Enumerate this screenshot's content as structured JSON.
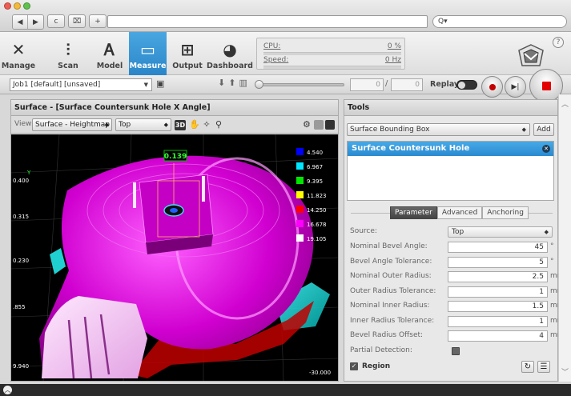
{
  "browser": {
    "nav_back": "◀",
    "nav_forward": "▶",
    "reload": "c",
    "bookmark": "⌧",
    "new_tab": "+",
    "search_prefix": "Q▾"
  },
  "nav": {
    "tabs": [
      {
        "label": "Manage",
        "icon": "wrench-icon",
        "glyph": "✕"
      },
      {
        "label": "Scan",
        "icon": "sliders-icon",
        "glyph": "⫶"
      },
      {
        "label": "Model",
        "icon": "model-icon",
        "glyph": "Ꭺ"
      },
      {
        "label": "Measure",
        "icon": "ruler-icon",
        "glyph": "▭"
      },
      {
        "label": "Output",
        "icon": "network-icon",
        "glyph": "⊞"
      },
      {
        "label": "Dashboard",
        "icon": "gauge-icon",
        "glyph": "◕"
      }
    ],
    "active": "Measure"
  },
  "stats": {
    "cpu_label": "CPU:",
    "cpu_value": "0 %",
    "cpu_fraction": 0,
    "speed_label": "Speed:",
    "speed_value": "0 Hz",
    "speed_fraction": 0
  },
  "help_label": "?",
  "jobbar": {
    "job": "Job1 [default] [unsaved]",
    "frame_current": "0",
    "frame_total": "0",
    "slash": "/",
    "replay_label": "Replay"
  },
  "left_panel": {
    "title": "Surface - [Surface Countersunk Hole X Angle]",
    "view_label": "View:",
    "view_mode": "Surface - Heightmap",
    "view_direction": "Top",
    "mode_3d": "3D",
    "measurement_value": "0.139",
    "axis_labels": [
      "0.400",
      "0.315",
      "0.230",
      ".855",
      "9.940"
    ],
    "axis_bottom_value": "-30.000",
    "legend": [
      {
        "value": "4.540",
        "color": "#0000ff"
      },
      {
        "value": "6.967",
        "color": "#00e6ff"
      },
      {
        "value": "9.395",
        "color": "#00e600"
      },
      {
        "value": "11.823",
        "color": "#ffff00"
      },
      {
        "value": "14.250",
        "color": "#ff0000"
      },
      {
        "value": "16.678",
        "color": "#ff00ff"
      },
      {
        "value": "19.105",
        "color": "#ffffff"
      }
    ]
  },
  "tools": {
    "title": "Tools",
    "selected_tool_type": "Surface Bounding Box",
    "add_label": "Add",
    "items": [
      "Surface Countersunk Hole"
    ],
    "tabs": [
      "Parameter",
      "Advanced",
      "Anchoring"
    ],
    "active_tab": "Parameter",
    "params": [
      {
        "label": "Source:",
        "value": "Top",
        "unit": "",
        "type": "select"
      },
      {
        "label": "Nominal Bevel Angle:",
        "value": "45",
        "unit": "°",
        "type": "input"
      },
      {
        "label": "Bevel Angle Tolerance:",
        "value": "5",
        "unit": "°",
        "type": "input"
      },
      {
        "label": "Nominal Outer Radius:",
        "value": "2.5",
        "unit": "mm",
        "type": "input"
      },
      {
        "label": "Outer Radius Tolerance:",
        "value": "1",
        "unit": "mm",
        "type": "input"
      },
      {
        "label": "Nominal Inner Radius:",
        "value": "1.5",
        "unit": "mm",
        "type": "input"
      },
      {
        "label": "Inner Radius Tolerance:",
        "value": "1",
        "unit": "mm",
        "type": "input"
      },
      {
        "label": "Bevel Radius Offset:",
        "value": "4",
        "unit": "mm",
        "type": "input"
      },
      {
        "label": "Partial Detection:",
        "value": "",
        "unit": "",
        "type": "checkbox"
      }
    ],
    "region_label": "Region"
  },
  "colors": {
    "accent": "#2a86c8",
    "stop_red": "#e20000",
    "part_magenta": "#d000d0"
  }
}
